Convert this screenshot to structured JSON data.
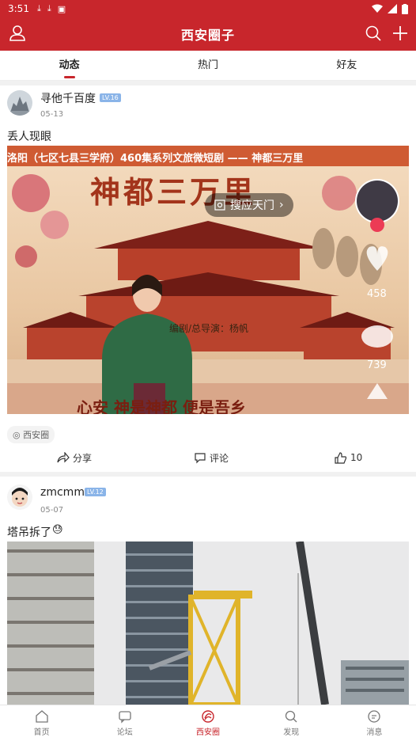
{
  "status": {
    "time": "3:51"
  },
  "header": {
    "title": "西安圈子"
  },
  "tabs": [
    "动态",
    "热门",
    "好友"
  ],
  "posts": [
    {
      "username": "寻他千百度",
      "level": "LV.16",
      "date": "05-13",
      "text": "丢人现眼",
      "video": {
        "top_caption": "洛阳（七区七县三学府）460集系列文旅微短剧 —— 神都三万里",
        "big_title": "神都三万里",
        "search_chip": "搜应天门",
        "credit": "编剧/总导演：杨帆",
        "bottom_caption": "心安 神是神都 便是吾乡",
        "like_count": "458",
        "comment_count": "739"
      },
      "circle": "西安圈",
      "share_label": "分享",
      "comment_label": "评论",
      "like_count": "10"
    },
    {
      "username": "zmcmm",
      "level": "LV.12",
      "date": "05-07",
      "text": "塔吊拆了"
    }
  ],
  "bottom_nav": [
    {
      "label": "首页"
    },
    {
      "label": "论坛"
    },
    {
      "label": "西安圈"
    },
    {
      "label": "发现"
    },
    {
      "label": "消息"
    }
  ],
  "colors": {
    "brand": "#c8262c"
  }
}
